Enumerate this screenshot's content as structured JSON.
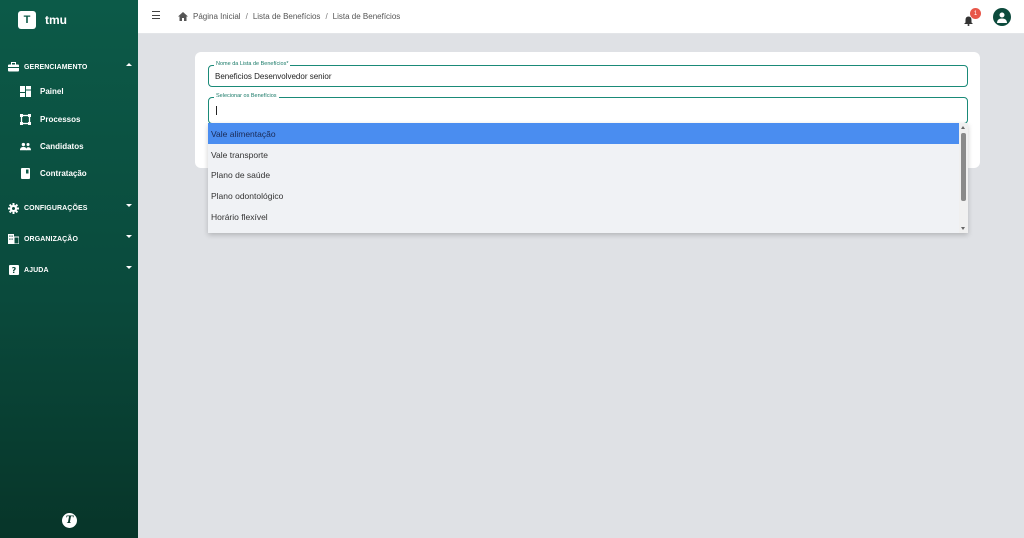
{
  "app": {
    "logo_letter": "T",
    "name": "tmu",
    "footer_logo": "T"
  },
  "sidebar": {
    "sections": [
      {
        "label": "GERENCIAMENTO",
        "icon": "briefcase-icon",
        "expanded": true
      },
      {
        "label": "CONFIGURAÇÕES",
        "icon": "gear-icon",
        "expanded": false
      },
      {
        "label": "ORGANIZAÇÃO",
        "icon": "building-icon",
        "expanded": false
      },
      {
        "label": "AJUDA",
        "icon": "help-icon",
        "expanded": false
      }
    ],
    "items": [
      {
        "label": "Painel",
        "icon": "dashboard-icon"
      },
      {
        "label": "Processos",
        "icon": "process-icon"
      },
      {
        "label": "Candidatos",
        "icon": "people-icon"
      },
      {
        "label": "Contratação",
        "icon": "contract-icon"
      }
    ]
  },
  "topbar": {
    "breadcrumb": [
      "Página Inicial",
      "Lista de Benefícios",
      "Lista de Benefícios"
    ],
    "notifications_count": "1"
  },
  "form": {
    "name_field": {
      "label": "Nome da Lista de Benefícios*",
      "value": "Beneficios Desenvolvedor senior"
    },
    "select_field": {
      "label": "Selecionar os Benefícios",
      "value": ""
    }
  },
  "dropdown": {
    "options": [
      "Vale alimentação",
      "Vale transporte",
      "Plano de saúde",
      "Plano odontológico",
      "Horário flexível"
    ],
    "selected_index": 0
  },
  "colors": {
    "sidebar": "#0c5a48",
    "accent": "#1a8a78",
    "highlight": "#4a8df0",
    "badge": "#e8574a"
  }
}
